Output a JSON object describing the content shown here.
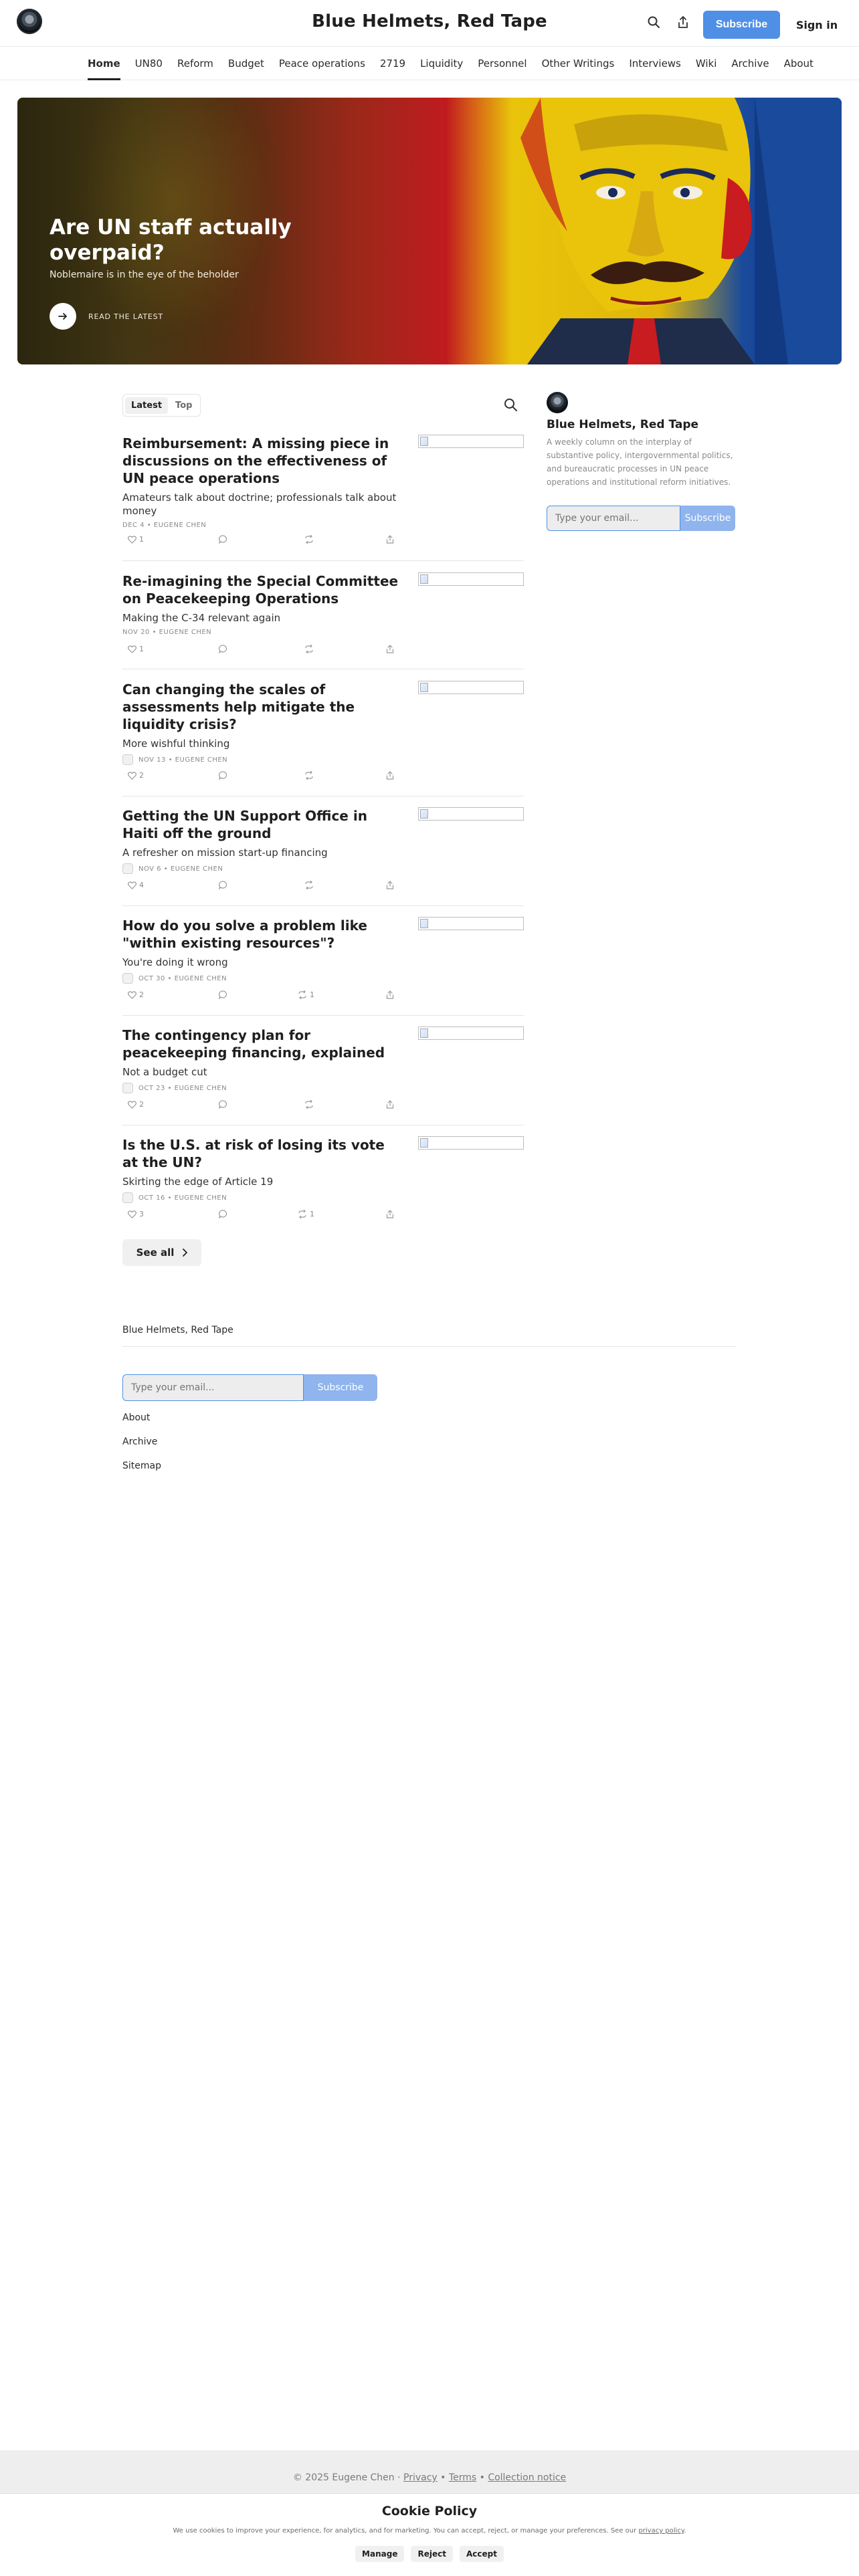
{
  "header": {
    "title": "Blue Helmets, Red Tape",
    "subscribe_label": "Subscribe",
    "signin_label": "Sign in",
    "icons": [
      "search-icon",
      "share-icon"
    ]
  },
  "nav": {
    "items": [
      {
        "label": "Home",
        "active": true
      },
      {
        "label": "UN80"
      },
      {
        "label": "Reform"
      },
      {
        "label": "Budget"
      },
      {
        "label": "Peace operations"
      },
      {
        "label": "2719"
      },
      {
        "label": "Liquidity"
      },
      {
        "label": "Personnel"
      },
      {
        "label": "Other Writings"
      },
      {
        "label": "Interviews"
      },
      {
        "label": "Wiki"
      },
      {
        "label": "Archive"
      },
      {
        "label": "About"
      }
    ]
  },
  "hero": {
    "title": "Are UN staff actually overpaid?",
    "subtitle": "Noblemaire is in the eye of the beholder",
    "cta_label": "READ THE LATEST",
    "colors": {
      "red": "#c81c20",
      "yellow": "#e9c40b",
      "blue": "#123a82"
    }
  },
  "feed": {
    "tabs": [
      {
        "label": "Latest",
        "active": true
      },
      {
        "label": "Top"
      }
    ],
    "posts": [
      {
        "title": "Reimbursement: A missing piece in discussions on the effectiveness of UN peace operations",
        "subtitle": "Amateurs talk about doctrine; professionals talk about money",
        "meta": "DEC 4 • EUGENE CHEN",
        "likes": "1",
        "restacks": "",
        "has_avatar": false
      },
      {
        "title": "Re-imagining the Special Committee on Peacekeeping Operations",
        "subtitle": "Making the C-34 relevant again",
        "meta": "NOV 20 • EUGENE CHEN",
        "likes": "1",
        "restacks": "",
        "has_avatar": false
      },
      {
        "title": "Can changing the scales of assessments help mitigate the liquidity crisis?",
        "subtitle": "More wishful thinking",
        "meta": "NOV 13 • EUGENE CHEN",
        "likes": "2",
        "restacks": "",
        "has_avatar": true
      },
      {
        "title": "Getting the UN Support Office in Haiti off the ground",
        "subtitle": "A refresher on mission start-up financing",
        "meta": "NOV 6 • EUGENE CHEN",
        "likes": "4",
        "restacks": "",
        "has_avatar": true
      },
      {
        "title": "How do you solve a problem like \"within existing resources\"?",
        "subtitle": "You're doing it wrong",
        "meta": "OCT 30 • EUGENE CHEN",
        "likes": "2",
        "restacks": "1",
        "has_avatar": true
      },
      {
        "title": "The contingency plan for peacekeeping financing, explained",
        "subtitle": "Not a budget cut",
        "meta": "OCT 23 • EUGENE CHEN",
        "likes": "2",
        "restacks": "",
        "has_avatar": true
      },
      {
        "title": "Is the U.S. at risk of losing its vote at the UN?",
        "subtitle": "Skirting the edge of Article 19",
        "meta": "OCT 16 • EUGENE CHEN",
        "likes": "3",
        "restacks": "1",
        "has_avatar": true
      }
    ],
    "see_all_label": "See all"
  },
  "sidebar": {
    "title": "Blue Helmets, Red Tape",
    "description": "A weekly column on the interplay of substantive policy, intergovernmental politics, and bureaucratic processes in UN peace operations and institutional reform initiatives.",
    "email_placeholder": "Type your email...",
    "subscribe_label": "Subscribe"
  },
  "footer": {
    "name": "Blue Helmets, Red Tape",
    "email_placeholder": "Type your email...",
    "subscribe_label": "Subscribe",
    "links": [
      "About",
      "Archive",
      "Sitemap"
    ],
    "copyright": "© 2025 Eugene Chen",
    "legal_links": [
      "Privacy",
      "Terms",
      "Collection notice"
    ]
  },
  "cookie": {
    "title": "Cookie Policy",
    "text": "We use cookies to improve your experience, for analytics, and for marketing. You can accept, reject, or manage your preferences. See our",
    "link": "privacy policy",
    "buttons": [
      "Manage",
      "Reject",
      "Accept"
    ]
  }
}
